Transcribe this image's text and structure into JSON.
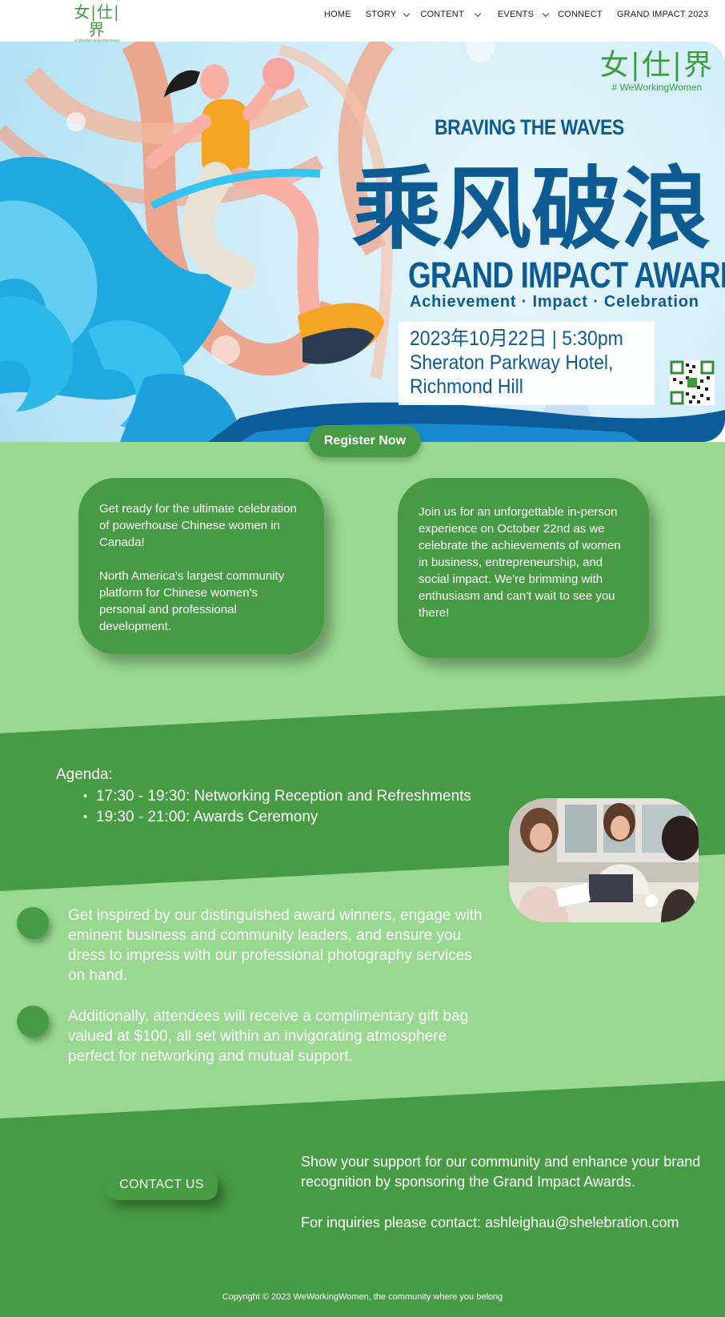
{
  "header": {
    "logo_cn": "女|仕|界",
    "logo_en": "# WeWorkingWomen",
    "nav": [
      {
        "label": "HOME",
        "has_dropdown": false
      },
      {
        "label": "STORY",
        "has_dropdown": true
      },
      {
        "label": "CONTENT",
        "has_dropdown": true
      },
      {
        "label": "EVENTS",
        "has_dropdown": true
      },
      {
        "label": "CONNECT",
        "has_dropdown": false
      },
      {
        "label": "GRAND IMPACT 2023",
        "has_dropdown": false
      }
    ]
  },
  "hero": {
    "logo_cn": "女|仕|界",
    "logo_en": "# WeWorkingWomen",
    "subtitle": "BRAVING THE WAVES",
    "title_cn": "乘风破浪",
    "title": "GRAND IMPACT AWARDS",
    "tagline": "Achievement · Impact · Celebration",
    "date_line": "2023年10月22日 | 5:30pm",
    "venue_line1": "Sheraton Parkway Hotel,",
    "venue_line2": "Richmond Hill"
  },
  "register_button": "Register Now",
  "cards": {
    "card1_p1": "Get ready for the ultimate celebration of powerhouse Chinese women in Canada!",
    "card1_p2": "North America's largest community platform for Chinese women's personal and professional development.",
    "card2_p1": "Join us for an unforgettable in-person experience on October 22nd as we celebrate the achievements of women in business, entrepreneurship, and social impact. We're brimming with enthusiasm and can't wait to see you there!"
  },
  "agenda": {
    "title": "Agenda:",
    "items": [
      "17:30 - 19:30: Networking Reception and Refreshments",
      "19:30 - 21:00: Awards Ceremony"
    ]
  },
  "highlights": [
    "Get inspired by our distinguished award winners, engage with eminent business and community leaders, and ensure you dress to impress with our professional photography services on hand.",
    "Additionally, attendees will receive a complimentary gift bag valued at $100, all set within an invigorating atmosphere perfect for networking and mutual support."
  ],
  "contact_button": "CONTACT US",
  "sponsor": {
    "line1": "Show your support for our community and enhance your brand recognition by sponsoring the Grand Impact Awards.",
    "line2": "For inquiries please contact: ashleighau@shelebration.com"
  },
  "footer": {
    "copyright": "Copyright © 2023 WeWorkingWomen, the community where you belong"
  },
  "colors": {
    "primary_green": "#479b44",
    "light_green": "#98d890",
    "hero_blue": "#0e5a93"
  }
}
